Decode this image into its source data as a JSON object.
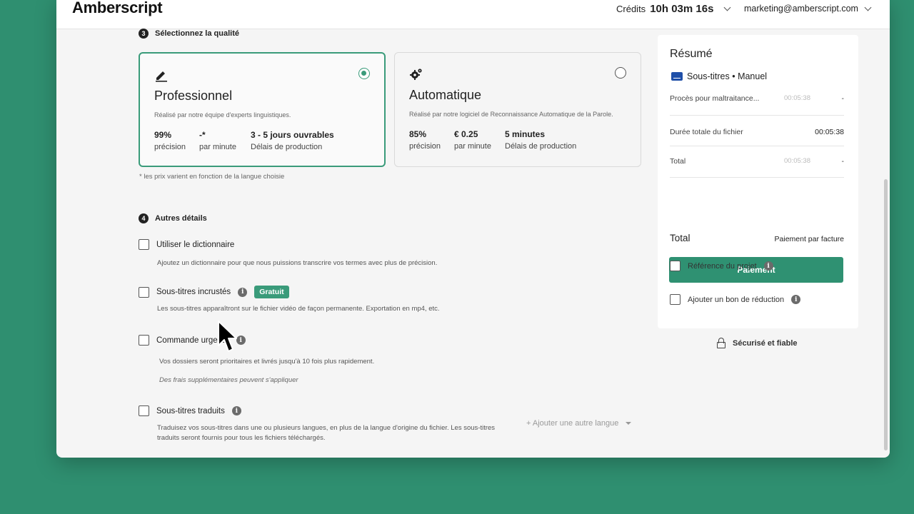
{
  "header": {
    "logo": "Amberscript",
    "credits_label": "Crédits",
    "credits_value": "10h 03m 16s",
    "account": "marketing@amberscript.com"
  },
  "quality": {
    "step": "3",
    "title": "Sélectionnez la qualité",
    "cards": [
      {
        "icon": "pen-icon",
        "title": "Professionnel",
        "desc": "Réalisé par notre équipe d'experts linguistiques.",
        "selected": true,
        "stats": [
          {
            "value": "99%",
            "label": "précision"
          },
          {
            "value": "-*",
            "label": "par minute"
          },
          {
            "value": "3 - 5 jours ouvrables",
            "label": "Délais de production"
          }
        ]
      },
      {
        "icon": "gear-icon",
        "title": "Automatique",
        "desc": "Réalisé par notre logiciel de Reconnaissance Automatique de la Parole.",
        "selected": false,
        "stats": [
          {
            "value": "85%",
            "label": "précision"
          },
          {
            "value": "€ 0.25",
            "label": "par minute"
          },
          {
            "value": "5 minutes",
            "label": "Délais de production"
          }
        ]
      }
    ],
    "note": "* les prix varient en fonction de la langue choisie"
  },
  "details": {
    "step": "4",
    "title": "Autres détails",
    "options": [
      {
        "label": "Utiliser le dictionnaire",
        "desc": "Ajoutez un dictionnaire pour que nous puissions transcrire vos termes avec plus de précision."
      },
      {
        "label": "Sous-titres incrustés",
        "badge": "Gratuit",
        "desc": "Les sous-titres apparaîtront sur le fichier vidéo de façon permanente. Exportation en mp4, etc."
      },
      {
        "label": "Commande urgente",
        "desc": "Vos dossiers seront prioritaires et livrés jusqu'à 10 fois plus rapidement.",
        "note": "Des frais supplémentaires peuvent s'appliquer"
      },
      {
        "label": "Sous-titres traduits",
        "desc_line1": "Traduisez vos sous-titres dans une ou plusieurs langues, en plus de la langue d'origine du fichier. Les sous-titres",
        "desc_line2": "traduits seront fournis pour tous les fichiers téléchargés.",
        "add_language": "+ Ajouter une autre langue"
      }
    ]
  },
  "summary": {
    "title": "Résumé",
    "service": "Sous-titres • Manuel",
    "file_name": "Procès pour maltraitance...",
    "file_duration": "00:05:38",
    "file_price": "-",
    "total_duration_label": "Durée totale du fichier",
    "total_duration": "00:05:38",
    "total_row_label": "Total",
    "total_row_duration": "00:05:38",
    "total_row_price": "-",
    "total_label": "Total",
    "payment_method": "Paiement par facture",
    "pay_button": "Paiement",
    "project_ref": "Référence du projet",
    "coupon": "Ajouter un bon de réduction"
  },
  "secure": "Sécurisé et fiable"
}
